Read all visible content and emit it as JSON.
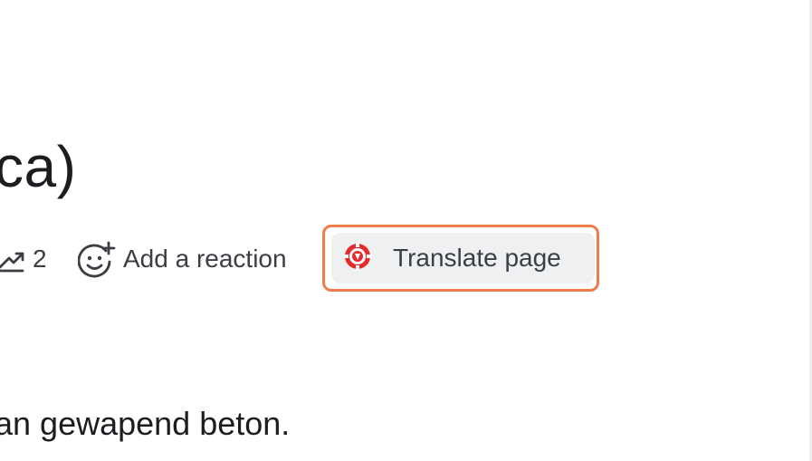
{
  "page": {
    "title_fragment": "ca)",
    "body_fragment": "an gewapend beton."
  },
  "meta": {
    "views_icon": "trending-up-icon",
    "views_count": "2",
    "reaction_icon": "smiley-plus-icon",
    "reaction_label": "Add a reaction",
    "translate_icon": "translate-extension-icon",
    "translate_label": "Translate page"
  },
  "colors": {
    "highlight_outline": "#f07c4a",
    "button_background": "#eff0f2",
    "translate_icon_red": "#e52b2b",
    "text_primary": "#1b1d21",
    "text_secondary": "#3b3e45"
  }
}
